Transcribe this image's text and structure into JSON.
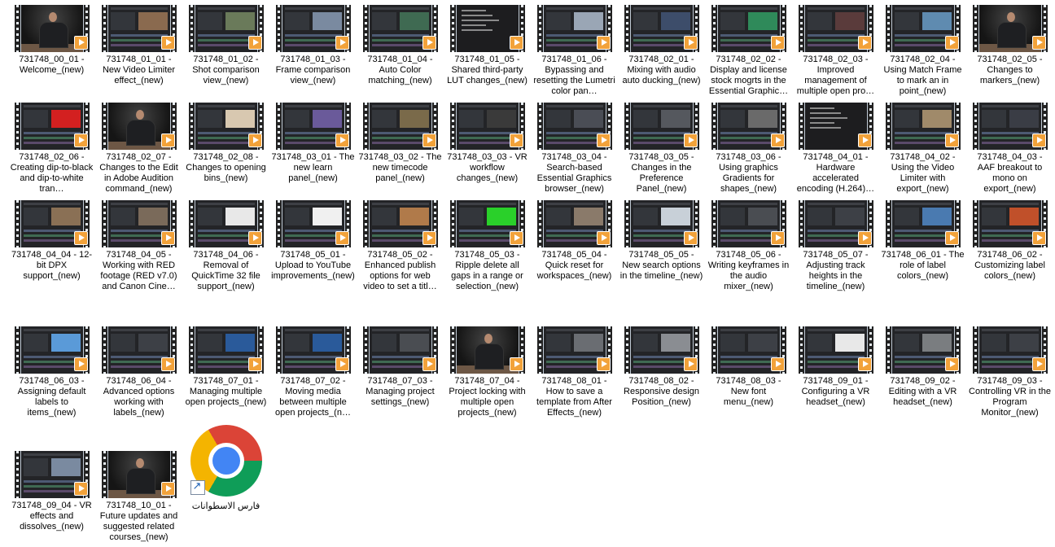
{
  "files": [
    {
      "label": "731748_00_01 - Welcome_(new)",
      "art": "person"
    },
    {
      "label": "731748_01_01 - New Video Limiter effect_(new)",
      "art": "ui",
      "accent": "#8a6a4f"
    },
    {
      "label": "731748_01_02 - Shot comparison view_(new)",
      "art": "ui",
      "accent": "#6a7a5a"
    },
    {
      "label": "731748_01_03 - Frame comparison view_(new)",
      "art": "ui",
      "accent": "#7a8aa0"
    },
    {
      "label": "731748_01_04 - Auto Color matching_(new)",
      "art": "ui",
      "accent": "#3f6a52"
    },
    {
      "label": "731748_01_05 - Shared third-party LUT changes_(new)",
      "art": "list"
    },
    {
      "label": "731748_01_06 - Bypassing and resetting the Lumetri color pan…",
      "art": "ui",
      "accent": "#9aa6b5"
    },
    {
      "label": "731748_02_01 - Mixing with audio auto ducking_(new)",
      "art": "ui",
      "accent": "#3d4d6a"
    },
    {
      "label": "731748_02_02 - Display and license stock mogrts in the Essential Graphic…",
      "art": "ui",
      "accent": "#2f8a5a"
    },
    {
      "label": "731748_02_03 - Improved management of multiple open pro…",
      "art": "ui",
      "accent": "#5a3b3b"
    },
    {
      "label": "731748_02_04 - Using Match Frame to mark an in point_(new)",
      "art": "ui",
      "accent": "#5f8bb0"
    },
    {
      "label": "731748_02_05 - Changes to markers_(new)",
      "art": "person"
    },
    {
      "label": "731748_02_06 - Creating dip-to-black and dip-to-white tran…",
      "art": "ui",
      "accent": "#d32020"
    },
    {
      "label": "731748_02_07 - Changes to the Edit in Adobe Audition command_(new)",
      "art": "person"
    },
    {
      "label": "731748_02_08 - Changes to opening bins_(new)",
      "art": "ui",
      "accent": "#d8c8b0"
    },
    {
      "label": "731748_03_01 - The new learn panel_(new)",
      "art": "ui",
      "accent": "#6a5a9a"
    },
    {
      "label": "731748_03_02 - The new timecode panel_(new)",
      "art": "ui",
      "accent": "#7a6a4a"
    },
    {
      "label": "731748_03_03 - VR workflow changes_(new)",
      "art": "ui",
      "accent": "#3a3a3a"
    },
    {
      "label": "731748_03_04 - Search-based Essential Graphics browser_(new)",
      "art": "ui",
      "accent": "#4a4d55"
    },
    {
      "label": "731748_03_05 - Changes in the Preference Panel_(new)",
      "art": "ui",
      "accent": "#55585e"
    },
    {
      "label": "731748_03_06 - Using graphics Gradients for shapes_(new)",
      "art": "ui",
      "accent": "#6a6a6a"
    },
    {
      "label": "731748_04_01 - Hardware accelerated encoding (H.264)…",
      "art": "list"
    },
    {
      "label": "731748_04_02 - Using the Video Limiter with export_(new)",
      "art": "ui",
      "accent": "#a08a6a"
    },
    {
      "label": "731748_04_03 - AAF breakout to mono on export_(new)",
      "art": "ui",
      "accent": "#3a3d45"
    },
    {
      "label": "731748_04_04 - 12-bit DPX support_(new)",
      "art": "ui",
      "accent": "#8a7055"
    },
    {
      "label": "731748_04_05 - Working with RED footage (RED v7.0) and Canon Cine…",
      "art": "ui",
      "accent": "#7a6a5a"
    },
    {
      "label": "731748_04_06 - Removal of QuickTime 32 file support_(new)",
      "art": "ui",
      "accent": "#e8e8e8"
    },
    {
      "label": "731748_05_01 - Upload to YouTube improvements_(new)",
      "art": "ui",
      "accent": "#f0f0f0"
    },
    {
      "label": "731748_05_02 - Enhanced publish options for web video to set a titl…",
      "art": "ui",
      "accent": "#b07a4a"
    },
    {
      "label": "731748_05_03 - Ripple delete all gaps in a range or selection_(new)",
      "art": "ui",
      "accent": "#2ad02a"
    },
    {
      "label": "731748_05_04 - Quick reset for workspaces_(new)",
      "art": "ui",
      "accent": "#8a7a6a"
    },
    {
      "label": "731748_05_05 - New search options in the timeline_(new)",
      "art": "ui",
      "accent": "#c8d0d8"
    },
    {
      "label": "731748_05_06 - Writing keyframes in the audio mixer_(new)",
      "art": "ui",
      "accent": "#4a4d52"
    },
    {
      "label": "731748_05_07 - Adjusting track heights in the timeline_(new)",
      "art": "ui",
      "accent": "#3d4046"
    },
    {
      "label": "731748_06_01 - The role of label colors_(new)",
      "art": "ui",
      "accent": "#4a7ab0"
    },
    {
      "label": "731748_06_02 - Customizing label colors_(new)",
      "art": "ui",
      "accent": "#c0502a"
    },
    {
      "label": "731748_06_03 - Assigning default labels to items_(new)",
      "art": "ui",
      "accent": "#5a9ad8"
    },
    {
      "label": "731748_06_04 - Advanced options working with labels_(new)",
      "art": "ui",
      "accent": "#3d4046"
    },
    {
      "label": "731748_07_01 - Managing multiple open projects_(new)",
      "art": "ui",
      "accent": "#2a5a9a"
    },
    {
      "label": "731748_07_02 - Moving media between multiple open projects_(n…",
      "art": "ui",
      "accent": "#2a5a9a"
    },
    {
      "label": "731748_07_03 - Managing project settings_(new)",
      "art": "ui",
      "accent": "#4a4d52"
    },
    {
      "label": "731748_07_04 - Project locking with multiple open projects_(new)",
      "art": "person"
    },
    {
      "label": "731748_08_01 - How to save a template from After Effects_(new)",
      "art": "ui",
      "accent": "#6a6d72"
    },
    {
      "label": "731748_08_02 - Responsive design Position_(new)",
      "art": "ui",
      "accent": "#8a8d92"
    },
    {
      "label": "731748_08_03 - New font menu_(new)",
      "art": "ui",
      "accent": "#3d4046"
    },
    {
      "label": "731748_09_01 - Configuring a VR headset_(new)",
      "art": "ui",
      "accent": "#e8e8e8"
    },
    {
      "label": "731748_09_02 - Editing with a VR headset_(new)",
      "art": "ui",
      "accent": "#7a7d80"
    },
    {
      "label": "731748_09_03 - Controlling VR in the Program Monitor_(new)",
      "art": "ui",
      "accent": "#3d4046"
    },
    {
      "label": "731748_09_04 - VR effects and dissolves_(new)",
      "art": "ui",
      "accent": "#7a8aa0"
    },
    {
      "label": "731748_10_01 - Future updates and suggested related courses_(new)",
      "art": "person"
    }
  ],
  "shortcut": {
    "label": "فارس الاسطوانات",
    "icon": "chrome-icon"
  }
}
